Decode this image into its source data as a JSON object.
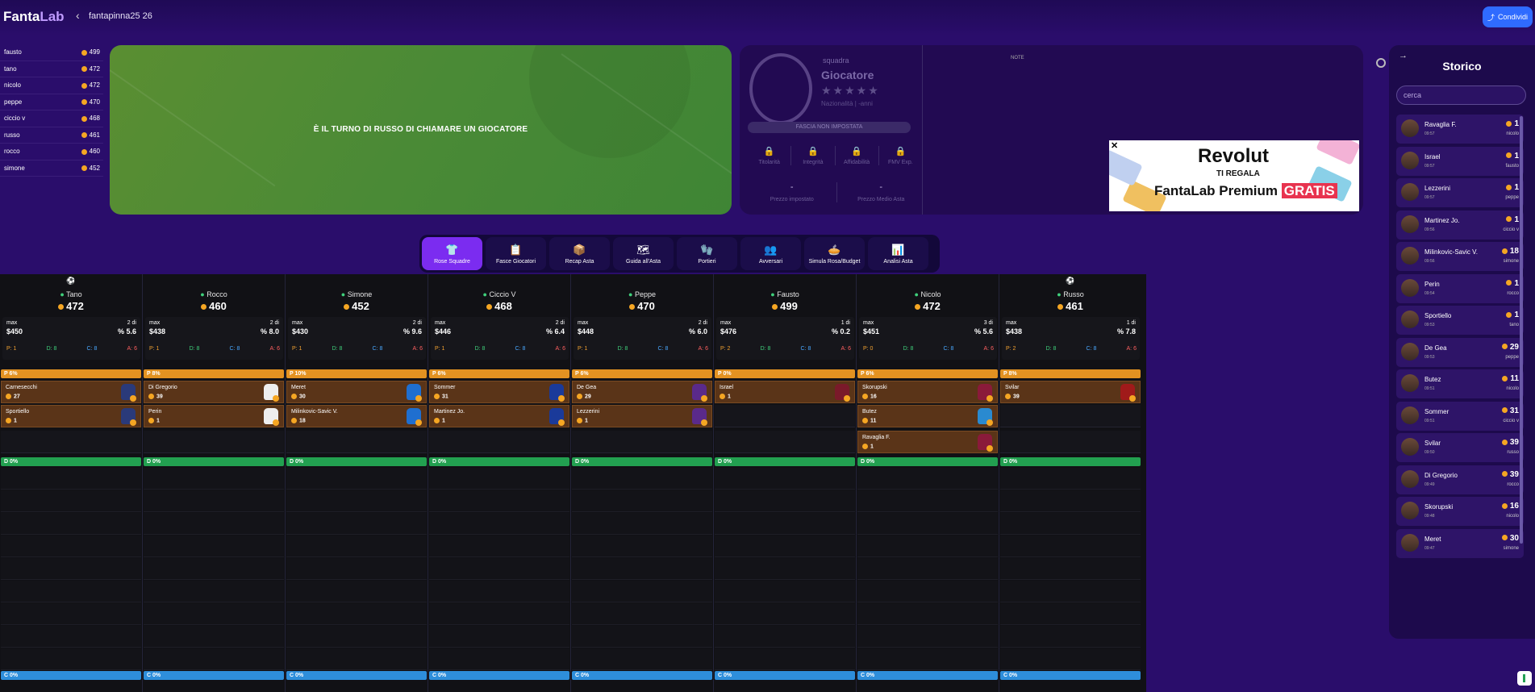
{
  "header": {
    "logo_main": "Fanta",
    "logo_accent": "Lab",
    "league": "fantapinna25 26",
    "share_label": "Condividi"
  },
  "budgets": [
    {
      "name": "fausto",
      "value": "499"
    },
    {
      "name": "tano",
      "value": "472"
    },
    {
      "name": "nicolo",
      "value": "472"
    },
    {
      "name": "peppe",
      "value": "470"
    },
    {
      "name": "ciccio v",
      "value": "468"
    },
    {
      "name": "russo",
      "value": "461"
    },
    {
      "name": "rocco",
      "value": "460"
    },
    {
      "name": "simone",
      "value": "452"
    }
  ],
  "field": {
    "turn_text": "È IL TURNO DI RUSSO DI CHIAMARE UN GIOCATORE"
  },
  "player_card": {
    "team_label": "squadra",
    "player_label": "Giocatore",
    "stars": "★★★★★",
    "nationality": "Nazionalità | -anni",
    "fascia": "FASCIA NON IMPOSTATA",
    "stats": [
      "Titolarità",
      "Integrità",
      "Affidabilità",
      "FMV Exp."
    ],
    "prices": [
      {
        "value": "-",
        "label": "Prezzo impostato"
      },
      {
        "value": "-",
        "label": "Prezzo Medio Asta"
      }
    ],
    "note": "NOTE"
  },
  "ad": {
    "close": "✕",
    "brand": "Revolut",
    "line": "TI REGALA",
    "product": "FantaLab Premium",
    "badge": "GRATIS"
  },
  "storico": {
    "title": "Storico",
    "search_placeholder": "cerca",
    "items": [
      {
        "name": "Ravaglia F.",
        "time": "09:57",
        "price": "1",
        "manager": "nicolo"
      },
      {
        "name": "Israel",
        "time": "09:57",
        "price": "1",
        "manager": "fausto"
      },
      {
        "name": "Lezzerini",
        "time": "09:57",
        "price": "1",
        "manager": "peppe"
      },
      {
        "name": "Martinez Jo.",
        "time": "09:56",
        "price": "1",
        "manager": "ciccio v"
      },
      {
        "name": "Milinkovic-Savic V.",
        "time": "09:56",
        "price": "18",
        "manager": "simone"
      },
      {
        "name": "Perin",
        "time": "09:54",
        "price": "1",
        "manager": "rocco"
      },
      {
        "name": "Sportiello",
        "time": "09:53",
        "price": "1",
        "manager": "tano"
      },
      {
        "name": "De Gea",
        "time": "09:53",
        "price": "29",
        "manager": "peppe"
      },
      {
        "name": "Butez",
        "time": "09:51",
        "price": "11",
        "manager": "nicolo"
      },
      {
        "name": "Sommer",
        "time": "09:51",
        "price": "31",
        "manager": "ciccio v"
      },
      {
        "name": "Svilar",
        "time": "09:50",
        "price": "39",
        "manager": "russo"
      },
      {
        "name": "Di Gregorio",
        "time": "09:49",
        "price": "39",
        "manager": "rocco"
      },
      {
        "name": "Skorupski",
        "time": "09:48",
        "price": "16",
        "manager": "nicolo"
      },
      {
        "name": "Meret",
        "time": "09:47",
        "price": "30",
        "manager": "simone"
      }
    ]
  },
  "tabs": [
    {
      "label": "Rose Squadre",
      "icon": "👕"
    },
    {
      "label": "Fasce Giocatori",
      "icon": "📋"
    },
    {
      "label": "Recap Asta",
      "icon": "📦"
    },
    {
      "label": "Guida all'Asta",
      "icon": "🗺"
    },
    {
      "label": "Portieri",
      "icon": "🧤"
    },
    {
      "label": "Avversari",
      "icon": "👥"
    },
    {
      "label": "Simula Rosa/Budget",
      "icon": "🥧"
    },
    {
      "label": "Analisi Asta",
      "icon": "📊"
    }
  ],
  "teams": [
    {
      "icon": "⚽",
      "name": "Tano",
      "budget": "472",
      "max": "max",
      "max_value": "$450",
      "of": "2 di",
      "pct": "% 5.6",
      "roles": [
        "P: 1",
        "D: 8",
        "C: 8",
        "A: 6"
      ],
      "p_band": "P  6%",
      "d_band": "D  0%",
      "c_band": "C  0%",
      "players": [
        {
          "name": "Carnesecchi",
          "price": "27",
          "color": "#2a3a7a"
        },
        {
          "name": "Sportiello",
          "price": "1",
          "color": "#2a3a7a"
        }
      ]
    },
    {
      "icon": "",
      "name": "Rocco",
      "budget": "460",
      "max": "max",
      "max_value": "$438",
      "of": "2 di",
      "pct": "% 8.0",
      "roles": [
        "P: 1",
        "D: 8",
        "C: 8",
        "A: 6"
      ],
      "p_band": "P  8%",
      "d_band": "D  0%",
      "c_band": "C  0%",
      "players": [
        {
          "name": "Di Gregorio",
          "price": "39",
          "color": "#eeeeee"
        },
        {
          "name": "Perin",
          "price": "1",
          "color": "#eeeeee"
        }
      ]
    },
    {
      "icon": "",
      "name": "Simone",
      "budget": "452",
      "max": "max",
      "max_value": "$430",
      "of": "2 di",
      "pct": "% 9.6",
      "roles": [
        "P: 1",
        "D: 8",
        "C: 8",
        "A: 6"
      ],
      "p_band": "P  10%",
      "d_band": "D  0%",
      "c_band": "C  0%",
      "players": [
        {
          "name": "Meret",
          "price": "30",
          "color": "#1f6fd0"
        },
        {
          "name": "Milinkovic-Savic V.",
          "price": "18",
          "color": "#1f6fd0"
        }
      ]
    },
    {
      "icon": "",
      "name": "Ciccio V",
      "budget": "468",
      "max": "max",
      "max_value": "$446",
      "of": "2 di",
      "pct": "% 6.4",
      "roles": [
        "P: 1",
        "D: 8",
        "C: 8",
        "A: 6"
      ],
      "p_band": "P  6%",
      "d_band": "D  0%",
      "c_band": "C  0%",
      "players": [
        {
          "name": "Sommer",
          "price": "31",
          "color": "#1a3a9a"
        },
        {
          "name": "Martinez Jo.",
          "price": "1",
          "color": "#1a3a9a"
        }
      ]
    },
    {
      "icon": "",
      "name": "Peppe",
      "budget": "470",
      "max": "max",
      "max_value": "$448",
      "of": "2 di",
      "pct": "% 6.0",
      "roles": [
        "P: 1",
        "D: 8",
        "C: 8",
        "A: 6"
      ],
      "p_band": "P  6%",
      "d_band": "D  0%",
      "c_band": "C  0%",
      "players": [
        {
          "name": "De Gea",
          "price": "29",
          "color": "#5a2a8a"
        },
        {
          "name": "Lezzerini",
          "price": "1",
          "color": "#5a2a8a"
        }
      ]
    },
    {
      "icon": "",
      "name": "Fausto",
      "budget": "499",
      "max": "max",
      "max_value": "$476",
      "of": "1 di",
      "pct": "% 0.2",
      "roles": [
        "P: 2",
        "D: 8",
        "C: 8",
        "A: 6"
      ],
      "p_band": "P  0%",
      "d_band": "D  0%",
      "c_band": "C  0%",
      "players": [
        {
          "name": "Israel",
          "price": "1",
          "color": "#7a1a2a"
        }
      ]
    },
    {
      "icon": "",
      "name": "Nicolo",
      "budget": "472",
      "max": "max",
      "max_value": "$451",
      "of": "3 di",
      "pct": "% 5.6",
      "roles": [
        "P: 0",
        "D: 8",
        "C: 8",
        "A: 6"
      ],
      "p_band": "P  6%",
      "d_band": "D  0%",
      "c_band": "C  0%",
      "players": [
        {
          "name": "Skorupski",
          "price": "16",
          "color": "#8a1a3a"
        },
        {
          "name": "Butez",
          "price": "11",
          "color": "#2a8ad0"
        },
        {
          "name": "Ravaglia F.",
          "price": "1",
          "color": "#8a1a3a"
        }
      ]
    },
    {
      "icon": "⚽",
      "name": "Russo",
      "budget": "461",
      "max": "max",
      "max_value": "$438",
      "of": "1 di",
      "pct": "% 7.8",
      "roles": [
        "P: 2",
        "D: 8",
        "C: 8",
        "A: 6"
      ],
      "p_band": "P  8%",
      "d_band": "D  0%",
      "c_band": "C  0%",
      "players": [
        {
          "name": "Svilar",
          "price": "39",
          "color": "#a01a1a"
        }
      ]
    }
  ]
}
